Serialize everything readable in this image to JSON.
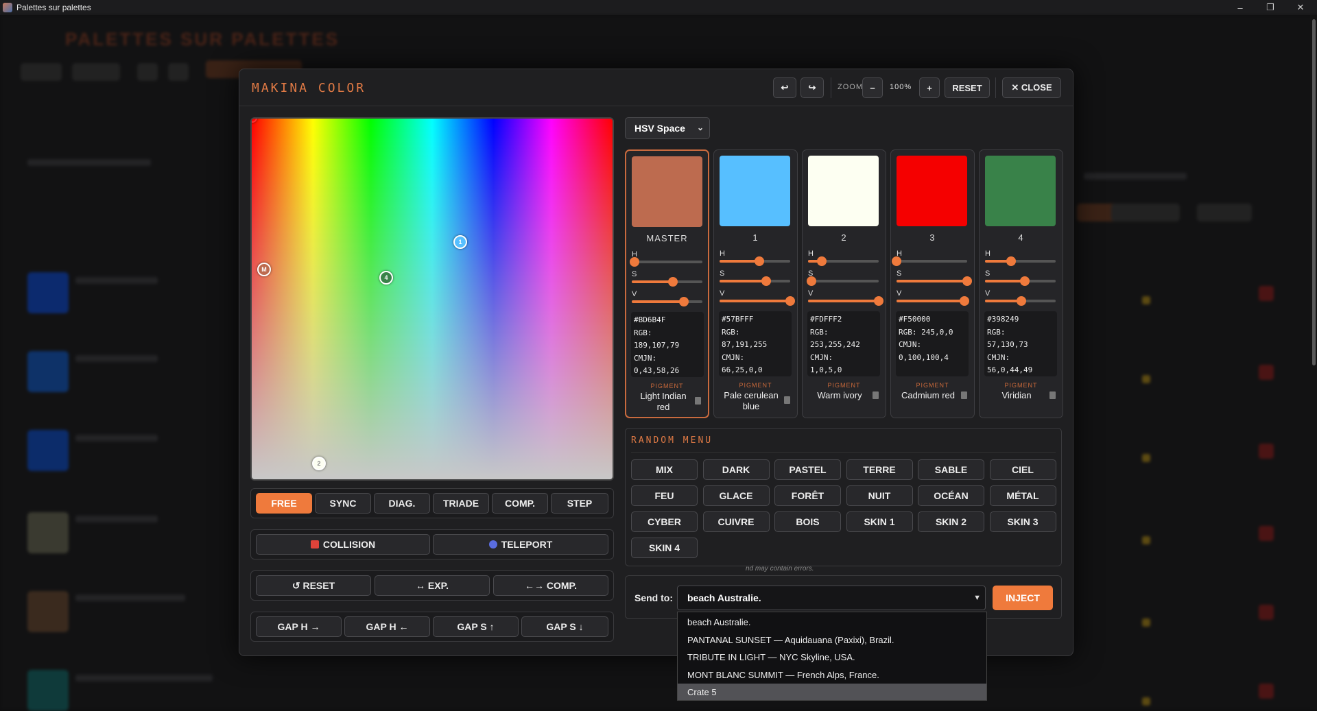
{
  "window": {
    "title": "Palettes sur palettes",
    "minimize": "–",
    "maximize": "❐",
    "close": "✕"
  },
  "modal": {
    "title": "MAKINA COLOR",
    "undo_icon": "↩",
    "redo_icon": "↪",
    "zoom_label": "ZOOM",
    "zoom_minus": "−",
    "zoom_value": "100%",
    "zoom_plus": "+",
    "reset": "RESET",
    "close": "✕ CLOSE"
  },
  "field_markers": [
    {
      "label": "M",
      "color": "#BD6B4F"
    },
    {
      "label": "1",
      "color": "#57BFFF"
    },
    {
      "label": "2",
      "color": "#FDFFF2"
    },
    {
      "label": "4",
      "color": "#398249"
    }
  ],
  "modes": {
    "tabs": [
      "FREE",
      "SYNC",
      "DIAG.",
      "TRIADE",
      "COMP.",
      "STEP"
    ],
    "active": "FREE",
    "collision": "COLLISION",
    "teleport": "TELEPORT",
    "reset": "↺ RESET",
    "expand": "↔ EXP.",
    "compress": "←→ COMP.",
    "gap_h_right": "GAP H →",
    "gap_h_left": "GAP H ←",
    "gap_s_up": "GAP S ↑",
    "gap_s_down": "GAP S ↓"
  },
  "space_select": {
    "value": "HSV Space"
  },
  "slider_labels": {
    "h": "H",
    "s": "S",
    "v": "V"
  },
  "pigment_label": "PIGMENT",
  "cards": [
    {
      "name": "MASTER",
      "color": "#BD6B4F",
      "hex": "#BD6B4F",
      "rgb_label": "RGB:",
      "rgb": "189,107,79",
      "cmjn_label": "CMJN:",
      "cmjn": "0,43,58,26",
      "pigment": "Light Indian red",
      "h": 0.04,
      "s": 0.58,
      "v": 0.74
    },
    {
      "name": "1",
      "color": "#57BFFF",
      "hex": "#57BFFF",
      "rgb_label": "RGB:",
      "rgb": "87,191,255",
      "cmjn_label": "CMJN:",
      "cmjn": "66,25,0,0",
      "pigment": "Pale cerulean blue",
      "h": 0.56,
      "s": 0.66,
      "v": 1.0
    },
    {
      "name": "2",
      "color": "#FDFFF2",
      "hex": "#FDFFF2",
      "rgb_label": "RGB:",
      "rgb": "253,255,242",
      "cmjn_label": "CMJN:",
      "cmjn": "1,0,5,0",
      "pigment": "Warm ivory",
      "h": 0.19,
      "s": 0.05,
      "v": 1.0
    },
    {
      "name": "3",
      "color": "#F50000",
      "hex": "#F50000",
      "rgb_label": "RGB: 245,0,0",
      "rgb": "",
      "cmjn_label": "CMJN:",
      "cmjn": "0,100,100,4",
      "pigment": "Cadmium red",
      "h": 0.0,
      "s": 1.0,
      "v": 0.96
    },
    {
      "name": "4",
      "color": "#398249",
      "hex": "#398249",
      "rgb_label": "RGB:",
      "rgb": "57,130,73",
      "cmjn_label": "CMJN:",
      "cmjn": "56,0,44,49",
      "pigment": "Viridian",
      "h": 0.37,
      "s": 0.56,
      "v": 0.51
    }
  ],
  "random_menu": {
    "title": "RANDOM MENU",
    "buttons": [
      "MIX",
      "DARK",
      "PASTEL",
      "TERRE",
      "SABLE",
      "CIEL",
      "FEU",
      "GLACE",
      "FORÊT",
      "NUIT",
      "OCÉAN",
      "MÉTAL",
      "CYBER",
      "CUIVRE",
      "BOIS",
      "SKIN 1",
      "SKIN 2",
      "SKIN 3",
      "SKIN 4"
    ]
  },
  "send": {
    "label": "Send to:",
    "value": "beach Australie.",
    "inject": "INJECT",
    "disclaimer": "nd may contain errors.",
    "options": [
      "beach Australie.",
      "PANTANAL SUNSET — Aquidauana (Paxixi), Brazil.",
      "TRIBUTE IN LIGHT — NYC Skyline, USA.",
      "MONT BLANC SUMMIT — French Alps, France.",
      "Crate 5"
    ],
    "highlighted": "Crate 5"
  },
  "background_app": {
    "logo": "PALETTES SUR PALETTES"
  }
}
